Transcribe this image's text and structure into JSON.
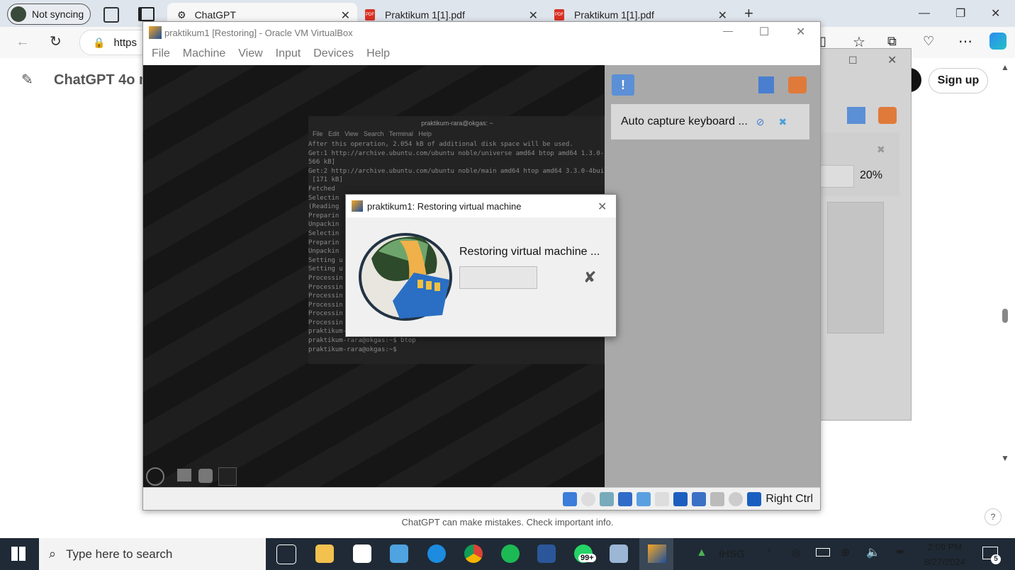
{
  "browser": {
    "profile_label": "Not syncing",
    "tabs": [
      {
        "label": "ChatGPT"
      },
      {
        "label": "Praktikum 1[1].pdf"
      },
      {
        "label": "Praktikum 1[1].pdf"
      }
    ],
    "address_text": "https",
    "new_tab": "+"
  },
  "page": {
    "title": "ChatGPT 4o m",
    "signup_label": "Sign up",
    "footer_text": "ChatGPT can make mistakes. Check important info.",
    "help_label": "?",
    "behind_percent": "20%"
  },
  "vbox": {
    "window_title": "praktikum1 [Restoring] - Oracle VM VirtualBox",
    "menu": [
      "File",
      "Machine",
      "View",
      "Input",
      "Devices",
      "Help"
    ],
    "notification_text": "Auto capture keyboard ...",
    "host_key": "Right Ctrl"
  },
  "terminal": {
    "title": "praktikum-rara@okgas: ~",
    "menu": [
      "File",
      "Edit",
      "View",
      "Search",
      "Terminal",
      "Help"
    ],
    "lines": [
      "After this operation, 2.054 kB of additional disk space will be used.",
      "Get:1 http://archive.ubuntu.com/ubuntu noble/universe amd64 btop amd64 1.3.0-1 [",
      "566 kB]",
      "Get:2 http://archive.ubuntu.com/ubuntu noble/main amd64 htop amd64 3.3.0-4build1",
      " [171 kB]",
      "Fetched",
      "Selectin",
      "(Reading",
      "Preparin",
      "Unpackin",
      "Selectin",
      "Preparin",
      "Unpackin",
      "Setting u",
      "Setting u",
      "Processin",
      "Processin",
      "Processin",
      "Processin",
      "Processin",
      "Processin",
      "praktikum-rara@okgas:~$ htop",
      "praktikum-rara@okgas:~$ btop",
      "praktikum-rara@okgas:~$ "
    ]
  },
  "dialog": {
    "title": "praktikum1: Restoring virtual machine",
    "message": "Restoring virtual machine ...",
    "progress": 0
  },
  "taskbar": {
    "search_placeholder": "Type here to search",
    "whatsapp_badge": "99+",
    "ihsg_label": "IHSG",
    "time": "2:09 PM",
    "date": "8/27/2024",
    "notification_count": "5"
  },
  "colors": {
    "taskbar_bg": "#1f2a36",
    "tabstrip_bg": "#dfe5ec",
    "vm_gray_panel": "#a9a9a9",
    "dialog_bg": "#f0f0f0"
  }
}
